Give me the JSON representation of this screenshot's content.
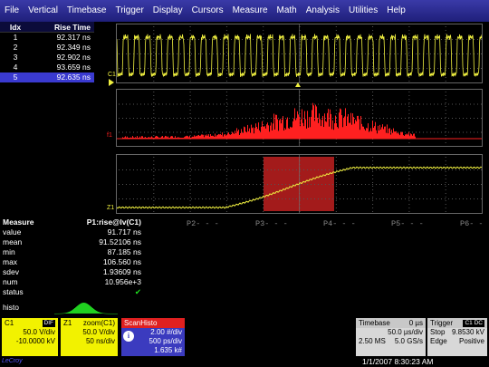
{
  "menu": [
    "File",
    "Vertical",
    "Timebase",
    "Trigger",
    "Display",
    "Cursors",
    "Measure",
    "Math",
    "Analysis",
    "Utilities",
    "Help"
  ],
  "rise_table": {
    "headers": [
      "Idx",
      "Rise Time"
    ],
    "rows": [
      {
        "idx": "1",
        "val": "92.317 ns"
      },
      {
        "idx": "2",
        "val": "92.349 ns"
      },
      {
        "idx": "3",
        "val": "92.902 ns"
      },
      {
        "idx": "4",
        "val": "93.659 ns"
      },
      {
        "idx": "5",
        "val": "92.635 ns"
      }
    ],
    "selected_row": 5
  },
  "traces": {
    "c1": "C1",
    "f1": "f1",
    "z1": "Z1"
  },
  "p_labels": [
    "P2- - -",
    "P3- - -",
    "P4- - -",
    "P5- - -",
    "P6- - -"
  ],
  "measure": {
    "header_key": "Measure",
    "header_val": "P1:rise@lv(C1)",
    "rows": [
      {
        "k": "value",
        "v": "91.717 ns"
      },
      {
        "k": "mean",
        "v": "91.52106 ns"
      },
      {
        "k": "min",
        "v": "87.185 ns"
      },
      {
        "k": "max",
        "v": "106.560 ns"
      },
      {
        "k": "sdev",
        "v": "1.93609 ns"
      },
      {
        "k": "num",
        "v": "10.956e+3"
      },
      {
        "k": "status",
        "v": "✔"
      }
    ],
    "histo_label": "histo"
  },
  "c1_panel": {
    "name": "C1",
    "tag": "DIF",
    "l1": "50.0 V/div",
    "l2": "-10.0000 kV"
  },
  "z1_panel": {
    "name": "Z1",
    "src": "zoom(C1)",
    "l1": "50.0 V/div",
    "l2": "50 ns/div"
  },
  "scan_panel": {
    "name": "ScanHisto",
    "l1": "2.00 #/div",
    "l2": "500 ps/div",
    "l3": "1.635 k#"
  },
  "timebase": {
    "title": "Timebase",
    "offset": "0 µs",
    "div": "50.0 µs/div",
    "rate_l": "2.50 MS",
    "rate_r": "5.0 GS/s"
  },
  "trigger": {
    "title": "Trigger",
    "tags": "C1 DC",
    "r1_l": "Stop",
    "r1_r": "9.8530 kV",
    "r2_l": "Edge",
    "r2_r": "Positive"
  },
  "datetime": "1/1/2007 8:30:23 AM",
  "logo": "LeCroy",
  "colors": {
    "trace_yellow": "#f0f040",
    "histo_red": "#ff2020",
    "menu_blue": "#2a2a90"
  }
}
